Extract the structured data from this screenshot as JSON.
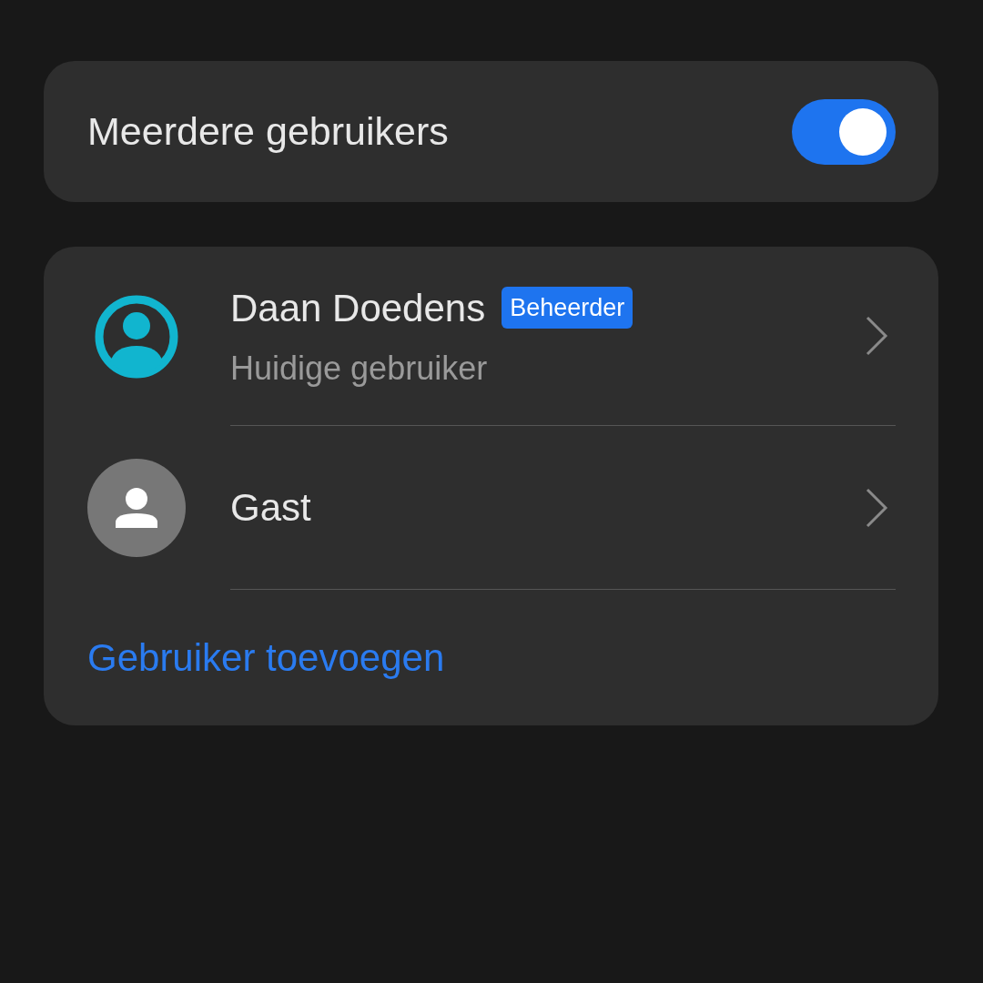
{
  "master_toggle": {
    "label": "Meerdere gebruikers",
    "on": true
  },
  "users": [
    {
      "kind": "current",
      "name": "Daan Doedens",
      "badge": "Beheerder",
      "subtitle": "Huidige gebruiker"
    },
    {
      "kind": "guest",
      "name": "Gast"
    }
  ],
  "add_user": "Gebruiker toevoegen"
}
